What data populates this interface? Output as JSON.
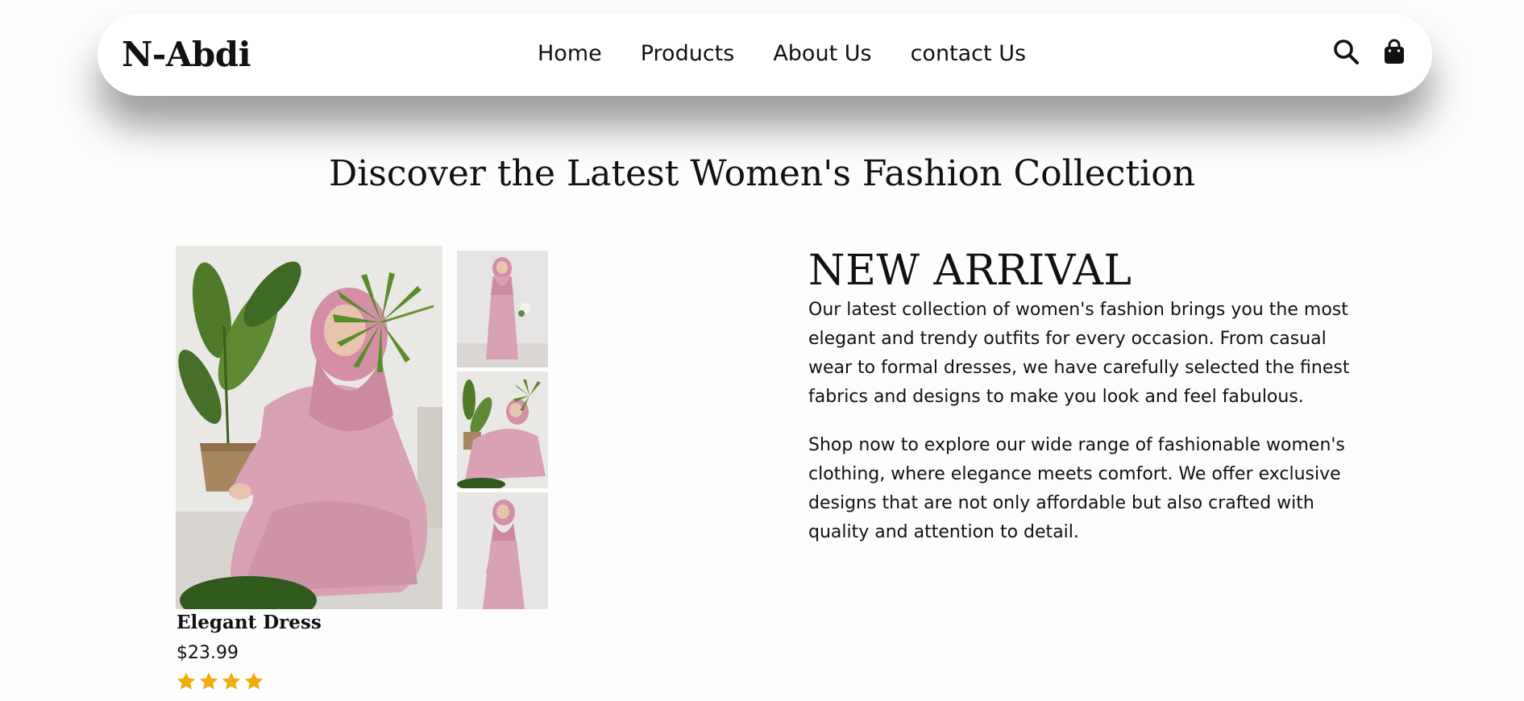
{
  "brand": {
    "logo_text": "N-Abdi"
  },
  "nav": {
    "links": [
      {
        "label": "Home"
      },
      {
        "label": "Products"
      },
      {
        "label": "About Us"
      },
      {
        "label": "contact Us"
      }
    ],
    "icons": [
      "search-icon",
      "shopping-bag-icon"
    ]
  },
  "hero": {
    "title": "Discover the Latest Women's Fashion Collection"
  },
  "product": {
    "name": "Elegant Dress",
    "price": "$23.99",
    "rating": 4,
    "rating_max": 4,
    "star_color": "#f0ad0c"
  },
  "arrival": {
    "title": "NEW ARRIVAL",
    "paragraph1": "Our latest collection of women's fashion brings you the most elegant and trendy outfits for every occasion. From casual wear to formal dresses, we have carefully selected the finest fabrics and designs to make you look and feel fabulous.",
    "paragraph2": "Shop now to explore our wide range of fashionable women's clothing, where elegance meets comfort. We offer exclusive designs that are not only affordable but also crafted with quality and attention to detail."
  },
  "colors": {
    "dress_pink": "#d9a1b4",
    "plant_green": "#4f7a2a",
    "background": "#fdfdfd"
  }
}
